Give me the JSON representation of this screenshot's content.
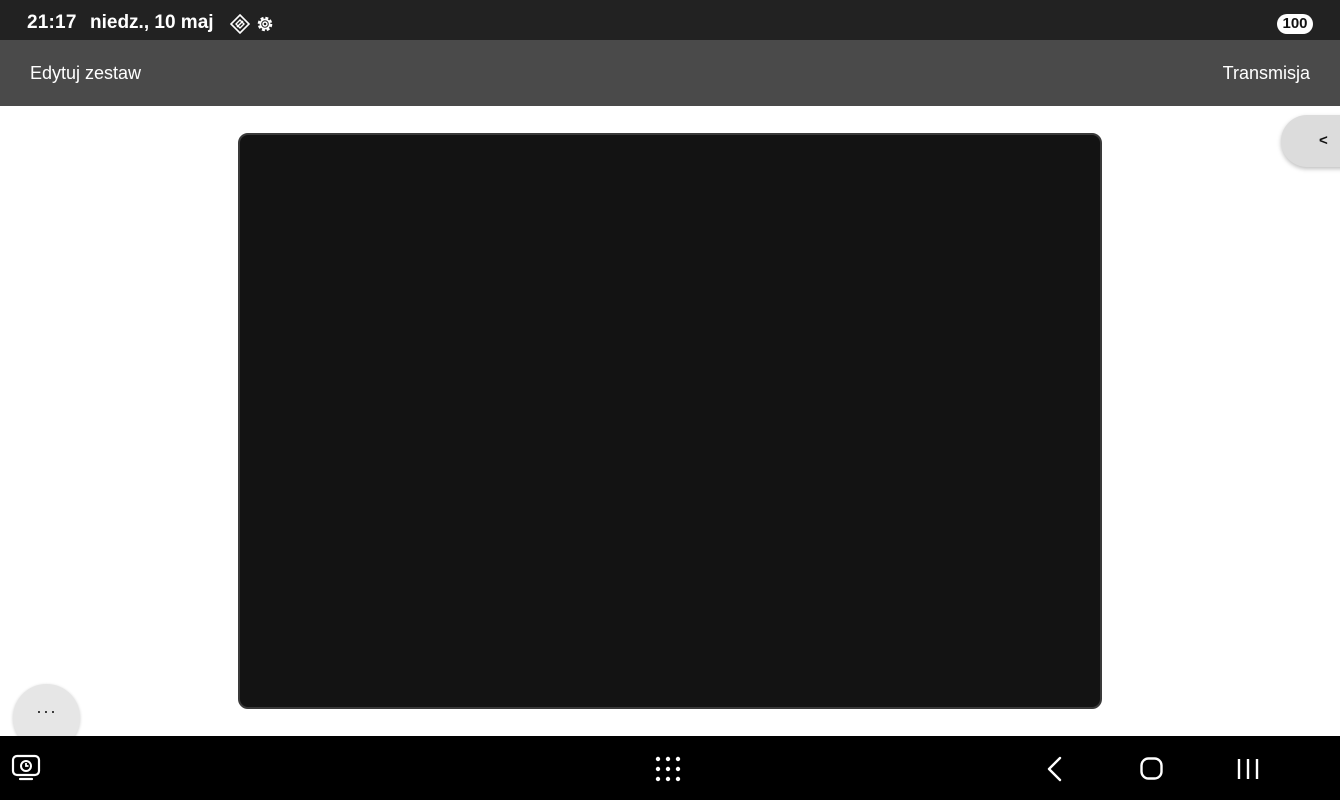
{
  "status_bar": {
    "time": "21:17",
    "date": "niedz., 10 maj",
    "battery": "100",
    "icons": [
      "diamond-sync-icon",
      "gear-icon"
    ]
  },
  "toolbar": {
    "left_label": "Edytuj zestaw",
    "right_label": "Transmisja"
  },
  "side_panel": {
    "toggle_label": "<"
  },
  "more_button": {
    "label": "···"
  },
  "nav_bar": {
    "icons": [
      "screen-recent-icon",
      "apps-grid-icon",
      "back-icon",
      "home-icon",
      "recents-icon"
    ]
  },
  "colors": {
    "status_bg": "#222222",
    "toolbar_bg": "#4a4a4a",
    "canvas_bg": "#131313",
    "nav_bg": "#000000"
  }
}
